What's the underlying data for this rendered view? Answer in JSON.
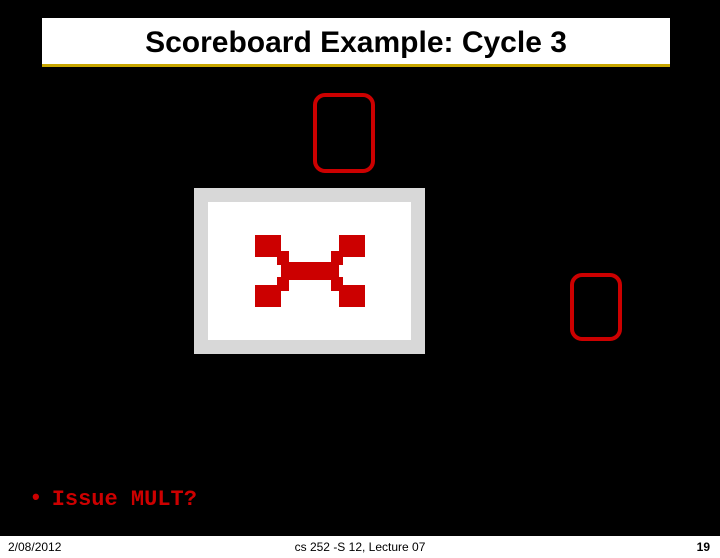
{
  "slide": {
    "title": "Scoreboard Example: Cycle 3",
    "bullet": "Issue MULT?"
  },
  "footer": {
    "date": "2/08/2012",
    "center": "cs 252 -S 12, Lecture 07",
    "page": "19"
  }
}
